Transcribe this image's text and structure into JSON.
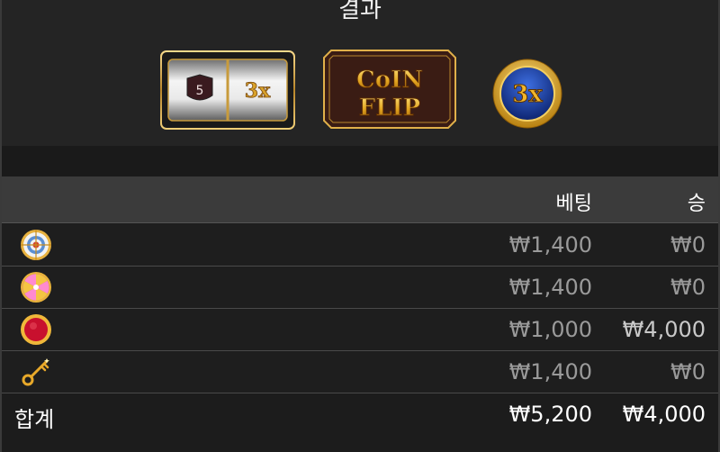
{
  "result": {
    "title": "결과",
    "reel": {
      "left": "5",
      "right": "3x"
    },
    "coin_flip": {
      "line1": "CoIN",
      "line2": "FLIP"
    },
    "multiplier": "3x"
  },
  "table": {
    "headers": {
      "bet": "베팅",
      "win": "승"
    },
    "rows": [
      {
        "icon": "target-icon",
        "bet": "₩1,400",
        "win": "₩0"
      },
      {
        "icon": "candy-swirl-icon",
        "bet": "₩1,400",
        "win": "₩0"
      },
      {
        "icon": "red-coin-icon",
        "bet": "₩1,000",
        "win": "₩4,000"
      },
      {
        "icon": "golden-key-icon",
        "bet": "₩1,400",
        "win": "₩0"
      }
    ],
    "total": {
      "label": "합계",
      "bet": "₩5,200",
      "win": "₩4,000"
    }
  },
  "colors": {
    "gold": "#d4a23a",
    "panel": "#242424",
    "header": "#3b3b3b",
    "red": "#c8102e",
    "blue": "#1a3fa8"
  }
}
